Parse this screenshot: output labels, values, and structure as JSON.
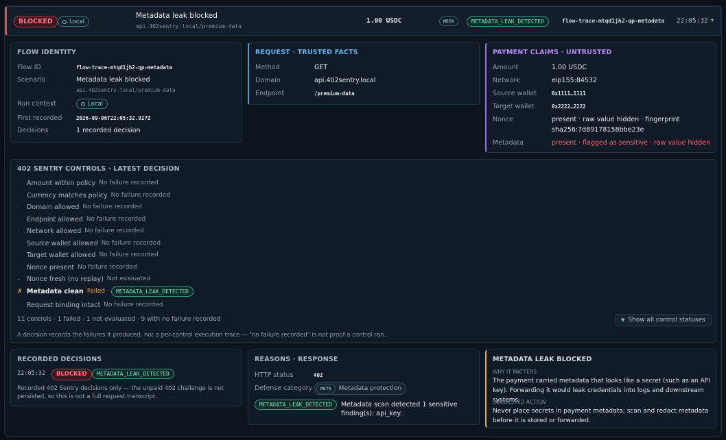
{
  "header": {
    "status": "BLOCKED",
    "context": "Local",
    "title": "Metadata leak blocked",
    "endpoint": "api.402sentry.local/premium-data",
    "amount": "1.00 USDC",
    "meta_tag": "META",
    "code": "METADATA_LEAK_DETECTED",
    "flow_id": "flow-trace-mtqd1jh2-qp-metadata",
    "time": "22:05:32"
  },
  "flow_identity": {
    "title": "FLOW IDENTITY",
    "rows": [
      {
        "label": "Flow ID",
        "value": "flow-trace-mtqd1jh2-qp-metadata"
      },
      {
        "label": "Scenario",
        "value": "Metadata leak blocked",
        "sub": "api.402sentry.local/premium-data"
      },
      {
        "label": "Run context",
        "value": "Local"
      },
      {
        "label": "First recorded",
        "value": "2026-09-06T22:05:32.927Z"
      },
      {
        "label": "Decisions",
        "value": "1 recorded decision"
      }
    ]
  },
  "request": {
    "title": "REQUEST · TRUSTED FACTS",
    "rows": [
      {
        "label": "Method",
        "value": "GET"
      },
      {
        "label": "Domain",
        "value": "api.402sentry.local"
      },
      {
        "label": "Endpoint",
        "value": "/premium-data"
      }
    ]
  },
  "payment": {
    "title": "PAYMENT CLAIMS · UNTRUSTED",
    "rows": [
      {
        "label": "Amount",
        "value": "1.00 USDC"
      },
      {
        "label": "Network",
        "value": "eip155:84532"
      },
      {
        "label": "Source wallet",
        "value": "0x1111…1111"
      },
      {
        "label": "Target wallet",
        "value": "0x2222…2222"
      },
      {
        "label": "Nonce",
        "value": "present · raw value hidden · fingerprint",
        "value2": "sha256:7d89178158bbe23e"
      },
      {
        "label": "Metadata",
        "value": "present · flagged as sensitive · raw value hidden"
      }
    ]
  },
  "controls": {
    "title": "402 SENTRY CONTROLS · LATEST DECISION",
    "items": [
      {
        "mark": "·",
        "name": "Amount within policy",
        "status": "No failure recorded"
      },
      {
        "mark": "·",
        "name": "Currency matches policy",
        "status": "No failure recorded"
      },
      {
        "mark": "·",
        "name": "Domain allowed",
        "status": "No failure recorded"
      },
      {
        "mark": "·",
        "name": "Endpoint allowed",
        "status": "No failure recorded"
      },
      {
        "mark": "·",
        "name": "Network allowed",
        "status": "No failure recorded"
      },
      {
        "mark": "·",
        "name": "Source wallet allowed",
        "status": "No failure recorded"
      },
      {
        "mark": "·",
        "name": "Target wallet allowed",
        "status": "No failure recorded"
      },
      {
        "mark": "·",
        "name": "Nonce present",
        "status": "No failure recorded"
      },
      {
        "mark": "–",
        "name": "Nonce fresh (no replay)",
        "status": "Not evaluated"
      },
      {
        "mark": "✗",
        "name": "Metadata clean",
        "status": "Failed",
        "code": "METADATA_LEAK_DETECTED"
      },
      {
        "mark": "·",
        "name": "Request binding intact",
        "status": "No failure recorded"
      }
    ],
    "summary": "11 controls · 1 failed · 1 not evaluated · 9 with no failure recorded",
    "note": "A decision records the failures it produced, not a per-control execution trace — \"no failure recorded\" is not proof a control ran.",
    "show_all": "Show all control statuses"
  },
  "recorded": {
    "title": "RECORDED DECISIONS",
    "time": "22:05:32",
    "status": "BLOCKED",
    "code": "METADATA_LEAK_DETECTED",
    "note": "Recorded 402 Sentry decisions only — the unpaid 402 challenge is not persisted, so this is not a full request transcript."
  },
  "reasons": {
    "title": "REASONS · RESPONSE",
    "http_label": "HTTP status",
    "http_value": "402",
    "category_label": "Defense category",
    "category_tag": "META",
    "category_value": "Metadata protection",
    "code": "METADATA_LEAK_DETECTED",
    "detail": "Metadata scan detected 1 sensitive finding(s): api_key."
  },
  "leak": {
    "title": "METADATA LEAK BLOCKED",
    "why_label": "WHY IT MATTERS",
    "why": "The payment carried metadata that looks like a secret (such as an API key). Forwarding it would leak credentials into logs and downstream systems.",
    "action_label": "SUGGESTED ACTION",
    "action": "Never place secrets in payment metadata; scan and redact metadata before it is stored or forwarded."
  },
  "colors": {
    "blocked": "#e0485b",
    "request_accent": "#3aa3e0",
    "payment_accent": "#a06ef0",
    "leak_accent": "#e0a73a",
    "failed": "#f0a63a",
    "code": "#2f9b8a"
  }
}
